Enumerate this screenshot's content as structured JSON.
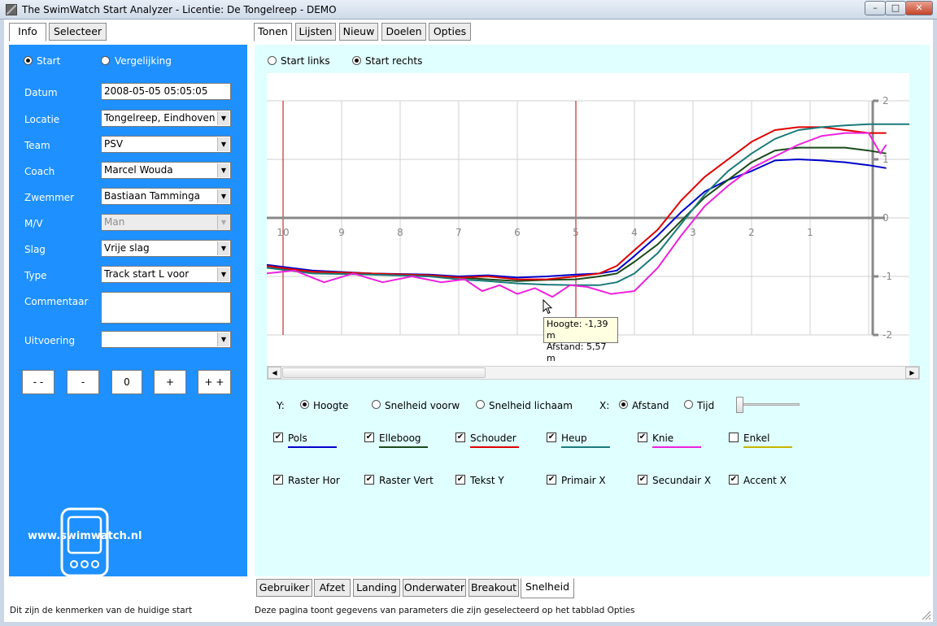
{
  "window": {
    "title": "The SwimWatch Start Analyzer - Licentie: De Tongelreep - DEMO",
    "controls": {
      "minimize": "–",
      "maximize": "□",
      "close": "✕"
    }
  },
  "left_tabs": [
    {
      "label": "Info",
      "active": true
    },
    {
      "label": "Selecteer",
      "active": false
    }
  ],
  "right_tabs": [
    {
      "label": "Tonen",
      "active": true
    },
    {
      "label": "Lijsten",
      "active": false
    },
    {
      "label": "Nieuw",
      "active": false
    },
    {
      "label": "Doelen",
      "active": false
    },
    {
      "label": "Opties",
      "active": false
    }
  ],
  "info": {
    "mode_start": "Start",
    "mode_compare": "Vergelijking",
    "fields": [
      {
        "label": "Datum",
        "value": "2008-05-05 05:05:05",
        "type": "text"
      },
      {
        "label": "Locatie",
        "value": "Tongelreep, Eindhoven",
        "type": "select"
      },
      {
        "label": "Team",
        "value": "PSV",
        "type": "select"
      },
      {
        "label": "Coach",
        "value": "Marcel Wouda",
        "type": "select"
      },
      {
        "label": "Zwemmer",
        "value": "Bastiaan Tamminga",
        "type": "select"
      },
      {
        "label": "M/V",
        "value": "Man",
        "type": "select-disabled"
      },
      {
        "label": "Slag",
        "value": "Vrije slag",
        "type": "select"
      },
      {
        "label": "Type",
        "value": "Track start L voor",
        "type": "select"
      },
      {
        "label": "Commentaar",
        "value": "",
        "type": "textarea"
      },
      {
        "label": "Uitvoering",
        "value": "",
        "type": "select"
      }
    ],
    "nav_buttons": [
      "- -",
      "-",
      "0",
      "+",
      "+ +"
    ],
    "website": "www.swimwatch.nl"
  },
  "view": {
    "start_left": "Start links",
    "start_right": "Start rechts",
    "tooltip": {
      "line1": "Hoogte: -1,39 m",
      "line2": "Afstand: 5,57 m"
    }
  },
  "controls": {
    "y_label": "Y:",
    "y_options": [
      "Hoogte",
      "Snelheid voorw",
      "Snelheid lichaam"
    ],
    "x_label": "X:",
    "x_options": [
      "Afstand",
      "Tijd"
    ],
    "series_toggles": [
      {
        "label": "Pols",
        "checked": true,
        "color": "#0000cc"
      },
      {
        "label": "Elleboog",
        "checked": true,
        "color": "#1a4a1a"
      },
      {
        "label": "Schouder",
        "checked": true,
        "color": "#e00000"
      },
      {
        "label": "Heup",
        "checked": true,
        "color": "#1a7a7a"
      },
      {
        "label": "Knie",
        "checked": true,
        "color": "#ee22dd"
      },
      {
        "label": "Enkel",
        "checked": false,
        "color": "#c8b400"
      }
    ],
    "display_toggles": [
      {
        "label": "Raster Hor",
        "checked": true
      },
      {
        "label": "Raster Vert",
        "checked": true
      },
      {
        "label": "Tekst Y",
        "checked": true
      },
      {
        "label": "Primair X",
        "checked": true
      },
      {
        "label": "Secundair X",
        "checked": true
      },
      {
        "label": "Accent X",
        "checked": true
      }
    ]
  },
  "bottom_tabs": [
    {
      "label": "Gebruiker",
      "active": false
    },
    {
      "label": "Afzet",
      "active": false
    },
    {
      "label": "Landing",
      "active": false
    },
    {
      "label": "Onderwater",
      "active": false
    },
    {
      "label": "Breakout",
      "active": false
    },
    {
      "label": "Snelheid",
      "active": true
    }
  ],
  "status": {
    "left": "Dit zijn de kenmerken van de huidige start",
    "right": "Deze pagina toont gegevens van parameters die zijn geselecteerd op het tabblad Opties"
  },
  "chart_data": {
    "type": "line",
    "xlabel": "",
    "ylabel": "",
    "x_reversed": true,
    "xlim": [
      10.2,
      -1.6
    ],
    "ylim": [
      -2.2,
      2.0
    ],
    "x_ticks": [
      "10",
      "9",
      "8",
      "7",
      "6",
      "5",
      "4",
      "3",
      "2",
      "1",
      "0"
    ],
    "y_ticks": [
      "2",
      "1",
      "0",
      "-1",
      "-2"
    ],
    "accent_x": [
      10,
      5
    ],
    "series": [
      {
        "name": "Pols",
        "color": "#0000cc",
        "x": [
          10.3,
          9.5,
          8.5,
          7.5,
          7.0,
          6.5,
          6.0,
          5.5,
          5.0,
          4.6,
          4.3,
          4.0,
          3.6,
          3.2,
          2.8,
          2.4,
          2.0,
          1.6,
          1.2,
          0.8,
          0.4,
          0.0,
          -0.3
        ],
        "y": [
          -0.8,
          -0.9,
          -0.95,
          -0.97,
          -1.0,
          -0.98,
          -1.02,
          -1.0,
          -0.97,
          -0.95,
          -0.9,
          -0.65,
          -0.3,
          0.1,
          0.45,
          0.65,
          0.8,
          0.98,
          1.0,
          0.98,
          0.95,
          0.9,
          0.85
        ]
      },
      {
        "name": "Elleboog",
        "color": "#1a4a1a",
        "x": [
          10.3,
          9.5,
          8.5,
          7.5,
          7.0,
          6.5,
          6.0,
          5.5,
          5.0,
          4.6,
          4.3,
          4.0,
          3.6,
          3.2,
          2.8,
          2.4,
          2.0,
          1.6,
          1.2,
          0.8,
          0.4,
          0.0,
          -0.3
        ],
        "y": [
          -0.85,
          -0.92,
          -0.95,
          -1.0,
          -1.02,
          -1.05,
          -1.08,
          -1.06,
          -1.05,
          -1.0,
          -0.95,
          -0.75,
          -0.45,
          -0.05,
          0.35,
          0.65,
          0.95,
          1.15,
          1.2,
          1.2,
          1.2,
          1.15,
          1.1
        ]
      },
      {
        "name": "Schouder",
        "color": "#e00000",
        "x": [
          10.3,
          9.5,
          8.5,
          7.5,
          7.0,
          6.5,
          6.0,
          5.5,
          5.0,
          4.6,
          4.3,
          4.0,
          3.6,
          3.2,
          2.8,
          2.4,
          2.0,
          1.6,
          1.2,
          0.8,
          0.4,
          0.0,
          -0.3
        ],
        "y": [
          -0.82,
          -0.92,
          -0.95,
          -0.98,
          -1.02,
          -1.0,
          -1.05,
          -1.05,
          -1.0,
          -0.95,
          -0.82,
          -0.55,
          -0.2,
          0.3,
          0.7,
          1.0,
          1.3,
          1.5,
          1.55,
          1.55,
          1.5,
          1.45,
          1.45
        ]
      },
      {
        "name": "Heup",
        "color": "#1a7a7a",
        "x": [
          10.3,
          9.5,
          8.5,
          7.5,
          7.0,
          6.5,
          6.0,
          5.5,
          5.0,
          4.6,
          4.3,
          4.0,
          3.6,
          3.2,
          2.8,
          2.4,
          2.0,
          1.6,
          1.2,
          0.8,
          0.4,
          0.0,
          -0.4,
          -0.8,
          -1.2,
          -1.5
        ],
        "y": [
          -0.85,
          -0.95,
          -0.97,
          -1.0,
          -1.05,
          -1.08,
          -1.12,
          -1.14,
          -1.15,
          -1.15,
          -1.1,
          -0.95,
          -0.6,
          -0.1,
          0.4,
          0.8,
          1.1,
          1.35,
          1.5,
          1.55,
          1.58,
          1.6,
          1.6,
          1.6,
          1.62,
          1.65
        ]
      },
      {
        "name": "Knie",
        "color": "#ee22dd",
        "x": [
          10.3,
          9.8,
          9.3,
          8.8,
          8.3,
          7.8,
          7.3,
          6.9,
          6.6,
          6.3,
          6.0,
          5.7,
          5.4,
          5.1,
          4.8,
          4.4,
          4.0,
          3.6,
          3.2,
          2.8,
          2.4,
          2.0,
          1.6,
          1.2,
          0.8,
          0.4,
          0.0,
          -0.2,
          -0.3
        ],
        "y": [
          -0.95,
          -0.9,
          -1.1,
          -0.95,
          -1.1,
          -1.0,
          -1.1,
          -1.05,
          -1.25,
          -1.15,
          -1.3,
          -1.2,
          -1.35,
          -1.15,
          -1.18,
          -1.3,
          -1.25,
          -0.85,
          -0.3,
          0.2,
          0.55,
          0.85,
          1.05,
          1.25,
          1.4,
          1.45,
          1.45,
          1.1,
          1.25
        ]
      }
    ]
  }
}
